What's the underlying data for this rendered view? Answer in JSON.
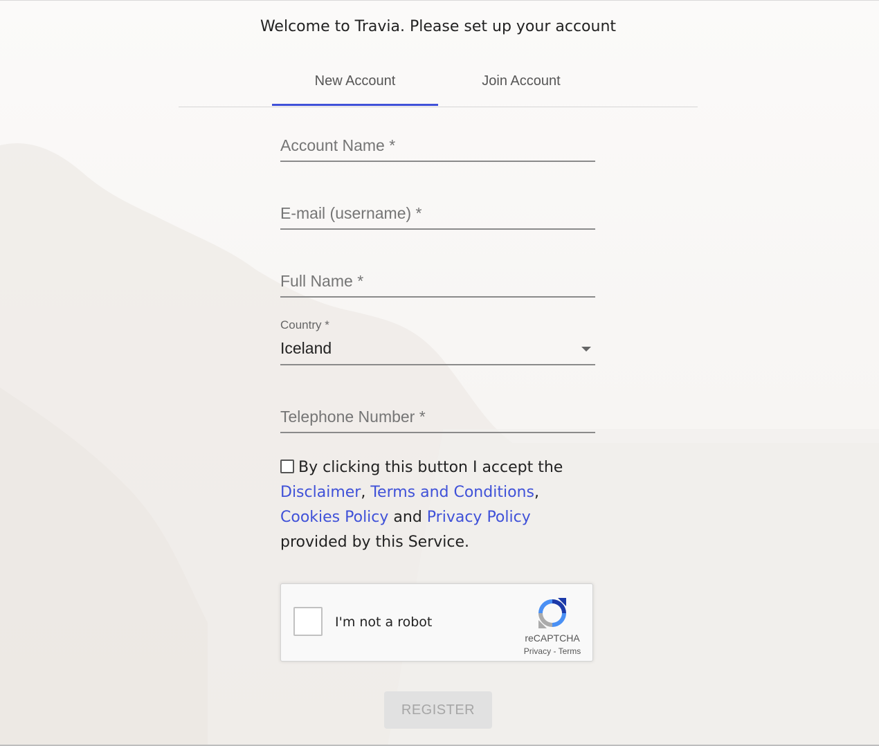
{
  "header": {
    "welcome": "Welcome to Travia. Please set up your account"
  },
  "tabs": [
    {
      "label": "New Account",
      "active": true
    },
    {
      "label": "Join Account",
      "active": false
    }
  ],
  "form": {
    "account_name": {
      "placeholder": "Account Name *",
      "value": ""
    },
    "email": {
      "placeholder": "E-mail (username) *",
      "value": ""
    },
    "full_name": {
      "placeholder": "Full Name *",
      "value": ""
    },
    "country": {
      "label": "Country *",
      "value": "Iceland"
    },
    "telephone": {
      "placeholder": "Telephone Number *",
      "value": ""
    }
  },
  "agreement": {
    "checked": false,
    "prefix": "By clicking this button I accept the",
    "link_disclaimer": "Disclaimer",
    "sep1": ",",
    "link_terms": "Terms and Conditions",
    "sep2": ",",
    "link_cookies": "Cookies Policy",
    "and": "and",
    "link_privacy": "Privacy Policy",
    "suffix": "provided by this Service."
  },
  "recaptcha": {
    "label": "I'm not a robot",
    "brand": "reCAPTCHA",
    "privacy": "Privacy",
    "separator": "-",
    "terms": "Terms",
    "checked": false
  },
  "register_button": {
    "label": "REGISTER",
    "disabled": true
  },
  "colors": {
    "accent": "#3f51d8",
    "link": "#3f51d8",
    "disabled_bg": "#e1e1e1",
    "disabled_text": "#a6a6a6"
  },
  "icons": {
    "dropdown": "caret-down-icon",
    "recaptcha_logo": "recaptcha-logo-icon"
  }
}
